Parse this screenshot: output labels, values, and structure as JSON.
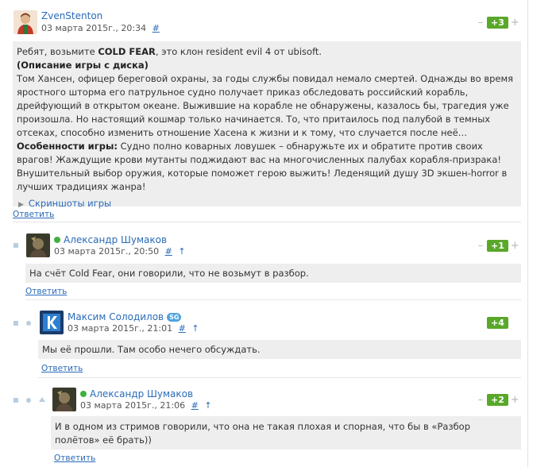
{
  "comments": [
    {
      "author": "ZvenStenton",
      "date": "03 марта 2015г., 20:34",
      "link": "#",
      "score": "+3",
      "reply": "Ответить",
      "paragraphs": {
        "intro_prefix": "Ребят, возьмите ",
        "intro_bold": "COLD FEAR",
        "intro_suffix": ", это клон resident evil 4 от ubisoft.",
        "desc_heading": "(Описание игры с диска)",
        "desc_text": "Том Хансен, офицер береговой охраны, за годы службы повидал немало смертей. Однажды во время яростного шторма его патрульное судно получает приказ обследовать российский корабль, дрейфующий в открытом океане. Выжившие на корабле не обнаружены, казалось бы, трагедия уже произошла. Но настоящий кошмар только начинается. То, что притаилось под палубой в темных отсеках, способно изменить отношение Хасена к жизни и к тому, что случается после неё…",
        "features_heading": "Особенности игры:",
        "features_text": " Судно полно коварных ловушек – обнаружьте их и обратите против своих врагов! Жаждущие крови мутанты поджидают вас на многочисленных палубах корабля-призрака! Внушительный выбор оружия, которые поможет герою выжить! Леденящий душу 3D экшен-horror в лучших традициях жанра!",
        "screenshots": "Скриншоты игры"
      }
    },
    {
      "author": "Александр Шумаков",
      "date": "03 марта 2015г., 20:50",
      "link": "#",
      "up": "↑",
      "score": "+1",
      "reply": "Ответить",
      "text": "На счёт Cold Fear, они говорили, что не возьмут в разбор."
    },
    {
      "author": "Максим Солодилов",
      "badge": "SG",
      "date": "03 марта 2015г., 21:01",
      "link": "#",
      "up": "↑",
      "score": "+4",
      "reply": "Ответить",
      "text": "Мы её прошли. Там особо нечего обсуждать."
    },
    {
      "author": "Александр Шумаков",
      "date": "03 марта 2015г., 21:06",
      "link": "#",
      "up": "↑",
      "score": "+2",
      "reply": "Ответить",
      "text": "И в одном из стримов говорили, что она не такая плохая и спорная, что бы в «Разбор полётов» её брать))"
    }
  ],
  "vote": {
    "minus": "–",
    "plus": "+"
  },
  "colors": {
    "link": "#2a6bb8",
    "score": "#5aa82a",
    "online": "#3fb03f",
    "body_bg": "#eeeeee"
  }
}
